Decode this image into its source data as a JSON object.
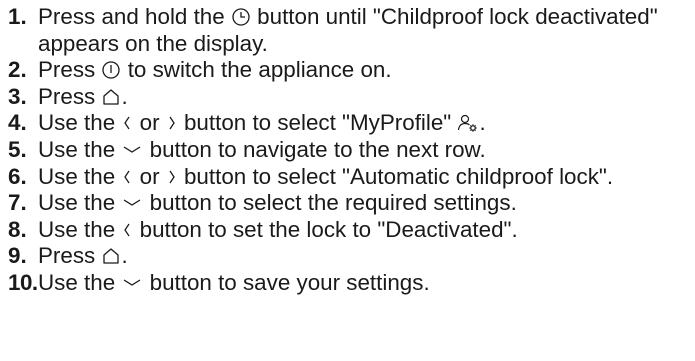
{
  "steps": [
    {
      "num": "1.",
      "parts": [
        "Press and hold the ",
        " button until \"Childproof lock deactivated\" appears on the display."
      ],
      "icons": [
        "clock-icon"
      ]
    },
    {
      "num": "2.",
      "parts": [
        "Press ",
        " to switch the appliance on."
      ],
      "icons": [
        "power-icon"
      ]
    },
    {
      "num": "3.",
      "parts": [
        "Press ",
        "."
      ],
      "icons": [
        "home-icon"
      ]
    },
    {
      "num": "4.",
      "parts": [
        "Use the ",
        " or ",
        " button to select \"MyProfile\" ",
        "."
      ],
      "icons": [
        "chevron-left-icon",
        "chevron-right-icon",
        "profile-settings-icon"
      ]
    },
    {
      "num": "5.",
      "parts": [
        "Use the ",
        " button to navigate to the next row."
      ],
      "icons": [
        "chevron-down-icon"
      ]
    },
    {
      "num": "6.",
      "parts": [
        "Use the ",
        " or ",
        " button to select \"Automatic childproof lock\"."
      ],
      "icons": [
        "chevron-left-icon",
        "chevron-right-icon"
      ]
    },
    {
      "num": "7.",
      "parts": [
        "Use the ",
        " button to select the required settings."
      ],
      "icons": [
        "chevron-down-icon"
      ]
    },
    {
      "num": "8.",
      "parts": [
        "Use the ",
        " button to set the lock to \"Deactivated\"."
      ],
      "icons": [
        "chevron-left-icon"
      ]
    },
    {
      "num": "9.",
      "parts": [
        "Press ",
        "."
      ],
      "icons": [
        "home-icon"
      ]
    },
    {
      "num": "10.",
      "parts": [
        "Use the ",
        " button to save your settings."
      ],
      "icons": [
        "chevron-down-icon"
      ]
    }
  ]
}
